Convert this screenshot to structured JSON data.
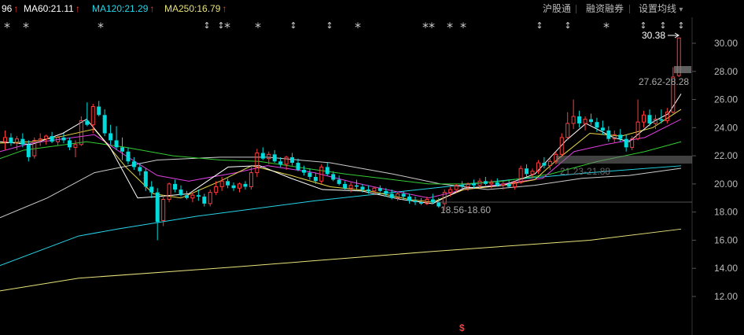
{
  "ma_legend": [
    {
      "text": "96",
      "color": "#ffffff",
      "arrow": "↑",
      "arrow_color": "#ff3b3b"
    },
    {
      "text": "MA60:21.11",
      "color": "#ffffff",
      "arrow": "↑",
      "arrow_color": "#ff3b3b"
    },
    {
      "text": "MA120:21.29",
      "color": "#27d4e8",
      "arrow": "↑",
      "arrow_color": "#ff3b3b"
    },
    {
      "text": "MA250:16.79",
      "color": "#e8e27a",
      "arrow": "↑",
      "arrow_color": "#ff3b3b"
    }
  ],
  "menu": {
    "hgt": "沪股通",
    "margin": "融资融券",
    "settings": "设置均线",
    "settings_caret": "▾"
  },
  "markers": {
    "star": "*",
    "updown": "↕"
  },
  "annotations": {
    "high": "30.38",
    "range1": "27.62-28.28",
    "range2": "21.23-21.88",
    "low": "18.56-18.60",
    "bottom_marker": "$"
  },
  "colors": {
    "up": "#ff3b3b",
    "down": "#00dcdc",
    "ma5": "#ffffff",
    "ma10": "#e8d84a",
    "ma20": "#e040e0",
    "ma30": "#33cc33",
    "ma60": "#cccccc",
    "ma120": "#27d4e8",
    "ma250": "#e8e27a"
  },
  "chart_data": {
    "type": "candlestick",
    "y_ticks": [
      "30.00",
      "28.00",
      "26.00",
      "24.00",
      "22.00",
      "20.00",
      "18.00",
      "16.00",
      "14.00",
      "12.00"
    ],
    "ylim": [
      10.8,
      31.4
    ],
    "candles": [
      [
        23.0,
        23.8,
        22.4,
        23.3
      ],
      [
        23.3,
        23.6,
        22.7,
        22.9
      ],
      [
        22.9,
        23.4,
        22.4,
        23.2
      ],
      [
        23.2,
        23.6,
        22.6,
        22.8
      ],
      [
        22.8,
        23.1,
        21.6,
        21.9
      ],
      [
        22.0,
        23.3,
        21.8,
        23.1
      ],
      [
        23.1,
        23.6,
        22.7,
        23.2
      ],
      [
        23.2,
        23.5,
        22.8,
        23.4
      ],
      [
        23.4,
        23.7,
        22.9,
        23.0
      ],
      [
        23.0,
        23.4,
        22.7,
        23.3
      ],
      [
        23.3,
        23.6,
        22.9,
        23.1
      ],
      [
        23.1,
        23.3,
        22.4,
        22.6
      ],
      [
        22.6,
        23.1,
        21.9,
        22.8
      ],
      [
        22.8,
        24.8,
        22.7,
        24.5
      ],
      [
        24.5,
        25.8,
        24.1,
        24.2
      ],
      [
        24.2,
        25.7,
        23.6,
        25.5
      ],
      [
        25.5,
        25.9,
        24.8,
        24.9
      ],
      [
        24.9,
        25.3,
        23.4,
        23.6
      ],
      [
        23.6,
        24.2,
        22.8,
        23.1
      ],
      [
        23.1,
        24.1,
        22.4,
        22.6
      ],
      [
        22.6,
        23.3,
        21.7,
        22.3
      ],
      [
        22.3,
        22.6,
        21.4,
        21.6
      ],
      [
        21.6,
        21.9,
        21.0,
        21.2
      ],
      [
        21.2,
        21.5,
        20.6,
        20.9
      ],
      [
        20.9,
        21.1,
        19.5,
        19.8
      ],
      [
        19.8,
        20.2,
        19.0,
        19.4
      ],
      [
        19.4,
        19.7,
        16.0,
        17.3
      ],
      [
        17.4,
        19.2,
        17.0,
        18.9
      ],
      [
        18.9,
        20.1,
        18.7,
        20.0
      ],
      [
        20.0,
        20.3,
        19.4,
        19.6
      ],
      [
        19.6,
        19.9,
        19.1,
        19.2
      ],
      [
        19.2,
        19.5,
        18.9,
        19.0
      ],
      [
        19.0,
        19.4,
        18.7,
        19.2
      ],
      [
        19.2,
        19.6,
        18.8,
        19.1
      ],
      [
        19.1,
        19.3,
        18.4,
        18.6
      ],
      [
        18.6,
        19.6,
        18.4,
        19.4
      ],
      [
        19.4,
        20.2,
        19.2,
        19.8
      ],
      [
        19.8,
        20.5,
        19.5,
        20.2
      ],
      [
        20.2,
        20.4,
        19.7,
        19.9
      ],
      [
        19.9,
        20.1,
        19.5,
        19.7
      ],
      [
        19.7,
        20.1,
        19.4,
        20.0
      ],
      [
        20.0,
        20.2,
        19.6,
        19.8
      ],
      [
        19.8,
        21.2,
        19.6,
        20.8
      ],
      [
        20.8,
        22.5,
        20.5,
        22.2
      ],
      [
        22.2,
        22.6,
        21.7,
        21.8
      ],
      [
        21.8,
        22.3,
        21.4,
        22.1
      ],
      [
        22.1,
        22.4,
        21.5,
        21.6
      ],
      [
        21.6,
        21.9,
        21.2,
        21.4
      ],
      [
        21.4,
        22.0,
        21.0,
        21.9
      ],
      [
        21.9,
        22.2,
        21.3,
        21.5
      ],
      [
        21.5,
        21.8,
        20.9,
        21.0
      ],
      [
        21.0,
        21.3,
        20.6,
        20.8
      ],
      [
        20.8,
        21.1,
        20.3,
        20.5
      ],
      [
        20.5,
        20.8,
        20.0,
        20.2
      ],
      [
        20.2,
        21.4,
        20.0,
        21.2
      ],
      [
        21.2,
        21.5,
        20.6,
        20.7
      ],
      [
        20.7,
        20.9,
        20.2,
        20.3
      ],
      [
        20.3,
        20.6,
        19.9,
        20.0
      ],
      [
        20.0,
        20.2,
        19.6,
        19.7
      ],
      [
        19.7,
        20.1,
        19.4,
        19.9
      ],
      [
        19.9,
        20.3,
        19.6,
        19.8
      ],
      [
        19.8,
        20.0,
        19.4,
        19.6
      ],
      [
        19.6,
        19.9,
        19.3,
        19.5
      ],
      [
        19.5,
        19.8,
        19.2,
        19.7
      ],
      [
        19.7,
        19.9,
        19.4,
        19.5
      ],
      [
        19.5,
        19.7,
        19.1,
        19.3
      ],
      [
        19.3,
        19.6,
        18.9,
        19.0
      ],
      [
        19.0,
        19.4,
        18.8,
        19.3
      ],
      [
        19.3,
        19.5,
        18.9,
        19.1
      ],
      [
        19.1,
        19.3,
        18.6,
        18.8
      ],
      [
        18.8,
        19.1,
        18.5,
        18.7
      ],
      [
        18.7,
        19.0,
        18.5,
        18.6
      ],
      [
        18.6,
        19.1,
        18.5,
        18.9
      ],
      [
        18.9,
        19.3,
        18.6,
        18.7
      ],
      [
        18.7,
        19.0,
        18.3,
        18.4
      ],
      [
        18.6,
        19.6,
        18.1,
        19.4
      ],
      [
        19.4,
        19.8,
        19.1,
        19.6
      ],
      [
        19.6,
        20.0,
        19.4,
        19.9
      ],
      [
        19.9,
        20.2,
        19.6,
        19.8
      ],
      [
        19.8,
        20.1,
        19.5,
        20.0
      ],
      [
        20.0,
        20.3,
        19.7,
        19.9
      ],
      [
        19.9,
        20.4,
        19.7,
        20.2
      ],
      [
        20.2,
        20.5,
        19.9,
        20.0
      ],
      [
        20.0,
        20.3,
        19.7,
        20.1
      ],
      [
        20.1,
        20.4,
        19.8,
        19.9
      ],
      [
        19.9,
        20.2,
        19.6,
        20.0
      ],
      [
        20.0,
        20.3,
        19.7,
        19.8
      ],
      [
        19.8,
        20.2,
        19.6,
        20.1
      ],
      [
        20.1,
        21.3,
        20.0,
        21.1
      ],
      [
        21.1,
        21.4,
        20.5,
        20.7
      ],
      [
        20.7,
        21.1,
        20.4,
        20.9
      ],
      [
        20.9,
        21.7,
        20.7,
        21.5
      ],
      [
        21.5,
        21.9,
        21.1,
        21.3
      ],
      [
        21.3,
        21.8,
        21.0,
        21.6
      ],
      [
        21.6,
        22.3,
        21.4,
        22.1
      ],
      [
        22.1,
        23.6,
        21.9,
        23.3
      ],
      [
        23.3,
        25.1,
        23.1,
        24.3
      ],
      [
        24.3,
        26.0,
        23.9,
        24.8
      ],
      [
        24.8,
        25.2,
        24.0,
        24.3
      ],
      [
        24.3,
        24.8,
        23.8,
        24.6
      ],
      [
        24.6,
        25.0,
        24.2,
        24.4
      ],
      [
        24.4,
        24.7,
        23.7,
        24.0
      ],
      [
        24.0,
        24.5,
        23.5,
        23.8
      ],
      [
        23.8,
        24.1,
        23.0,
        23.2
      ],
      [
        23.2,
        23.8,
        22.9,
        23.5
      ],
      [
        23.5,
        23.9,
        23.0,
        23.2
      ],
      [
        23.2,
        23.5,
        22.3,
        22.6
      ],
      [
        22.6,
        23.4,
        22.4,
        23.2
      ],
      [
        23.2,
        26.0,
        23.1,
        24.4
      ],
      [
        24.4,
        25.2,
        24.0,
        24.9
      ],
      [
        24.9,
        25.3,
        24.1,
        24.3
      ],
      [
        24.3,
        24.9,
        23.9,
        24.6
      ],
      [
        24.6,
        25.3,
        24.3,
        24.5
      ],
      [
        24.5,
        25.4,
        24.3,
        25.1
      ],
      [
        25.1,
        28.3,
        25.0,
        27.6
      ],
      [
        27.7,
        30.4,
        27.6,
        30.38
      ]
    ],
    "ma_lines": [
      {
        "name": "MA250",
        "color_key": "ma250",
        "points": [
          [
            0,
            12.4
          ],
          [
            100,
            13.3
          ],
          [
            300,
            14.1
          ],
          [
            550,
            15.2
          ],
          [
            750,
            16.0
          ],
          [
            866,
            16.79
          ]
        ]
      },
      {
        "name": "MA120",
        "color_key": "ma120",
        "points": [
          [
            0,
            14.2
          ],
          [
            100,
            16.3
          ],
          [
            150,
            16.8
          ],
          [
            250,
            17.7
          ],
          [
            400,
            18.8
          ],
          [
            550,
            19.7
          ],
          [
            650,
            20.3
          ],
          [
            750,
            20.8
          ],
          [
            866,
            21.29
          ]
        ]
      },
      {
        "name": "MA60",
        "color_key": "ma60",
        "points": [
          [
            0,
            17.6
          ],
          [
            60,
            19.0
          ],
          [
            120,
            20.8
          ],
          [
            200,
            21.7
          ],
          [
            280,
            21.9
          ],
          [
            340,
            21.9
          ],
          [
            420,
            21.5
          ],
          [
            500,
            20.7
          ],
          [
            560,
            20.0
          ],
          [
            620,
            19.6
          ],
          [
            680,
            19.9
          ],
          [
            740,
            20.4
          ],
          [
            800,
            20.6
          ],
          [
            866,
            21.11
          ]
        ]
      }
    ],
    "short_ma_lines": [
      {
        "color_key": "ma30",
        "points": [
          [
            0,
            21.8
          ],
          [
            30,
            22.4
          ],
          [
            70,
            22.7
          ],
          [
            110,
            23.0
          ],
          [
            160,
            22.6
          ],
          [
            220,
            22.0
          ],
          [
            280,
            21.7
          ],
          [
            330,
            21.6
          ],
          [
            390,
            21.1
          ],
          [
            440,
            20.7
          ],
          [
            500,
            20.3
          ],
          [
            545,
            20.0
          ],
          [
            590,
            20.0
          ],
          [
            640,
            20.2
          ],
          [
            700,
            20.7
          ],
          [
            760,
            21.6
          ],
          [
            820,
            22.3
          ],
          [
            866,
            23.0
          ]
        ]
      },
      {
        "color_key": "ma20",
        "points": [
          [
            0,
            22.3
          ],
          [
            40,
            22.9
          ],
          [
            80,
            23.2
          ],
          [
            120,
            23.5
          ],
          [
            160,
            22.0
          ],
          [
            200,
            20.6
          ],
          [
            240,
            20.2
          ],
          [
            300,
            20.8
          ],
          [
            340,
            21.3
          ],
          [
            400,
            20.8
          ],
          [
            450,
            20.1
          ],
          [
            500,
            19.5
          ],
          [
            545,
            19.0
          ],
          [
            590,
            19.6
          ],
          [
            640,
            20.0
          ],
          [
            690,
            20.4
          ],
          [
            730,
            22.3
          ],
          [
            770,
            22.8
          ],
          [
            820,
            23.3
          ],
          [
            866,
            24.6
          ]
        ]
      },
      {
        "color_key": "ma10",
        "points": [
          [
            0,
            22.9
          ],
          [
            40,
            23.0
          ],
          [
            80,
            23.4
          ],
          [
            120,
            23.9
          ],
          [
            160,
            21.2
          ],
          [
            195,
            19.3
          ],
          [
            230,
            19.0
          ],
          [
            280,
            20.2
          ],
          [
            320,
            21.3
          ],
          [
            370,
            20.6
          ],
          [
            420,
            19.8
          ],
          [
            470,
            19.5
          ],
          [
            520,
            18.9
          ],
          [
            550,
            18.7
          ],
          [
            590,
            19.6
          ],
          [
            640,
            19.9
          ],
          [
            680,
            20.3
          ],
          [
            710,
            21.8
          ],
          [
            750,
            23.6
          ],
          [
            790,
            23.4
          ],
          [
            830,
            24.0
          ],
          [
            866,
            25.3
          ]
        ]
      },
      {
        "color_key": "ma5",
        "points": [
          [
            0,
            23.0
          ],
          [
            40,
            22.8
          ],
          [
            80,
            23.6
          ],
          [
            110,
            24.6
          ],
          [
            140,
            22.6
          ],
          [
            175,
            19.0
          ],
          [
            200,
            19.1
          ],
          [
            240,
            19.3
          ],
          [
            290,
            21.2
          ],
          [
            330,
            21.3
          ],
          [
            370,
            20.4
          ],
          [
            410,
            19.6
          ],
          [
            460,
            19.5
          ],
          [
            510,
            18.9
          ],
          [
            550,
            18.6
          ],
          [
            590,
            19.7
          ],
          [
            640,
            19.9
          ],
          [
            680,
            20.7
          ],
          [
            720,
            23.1
          ],
          [
            745,
            24.3
          ],
          [
            780,
            23.3
          ],
          [
            800,
            23.0
          ],
          [
            830,
            24.4
          ],
          [
            850,
            25.0
          ],
          [
            866,
            26.4
          ]
        ]
      }
    ]
  }
}
